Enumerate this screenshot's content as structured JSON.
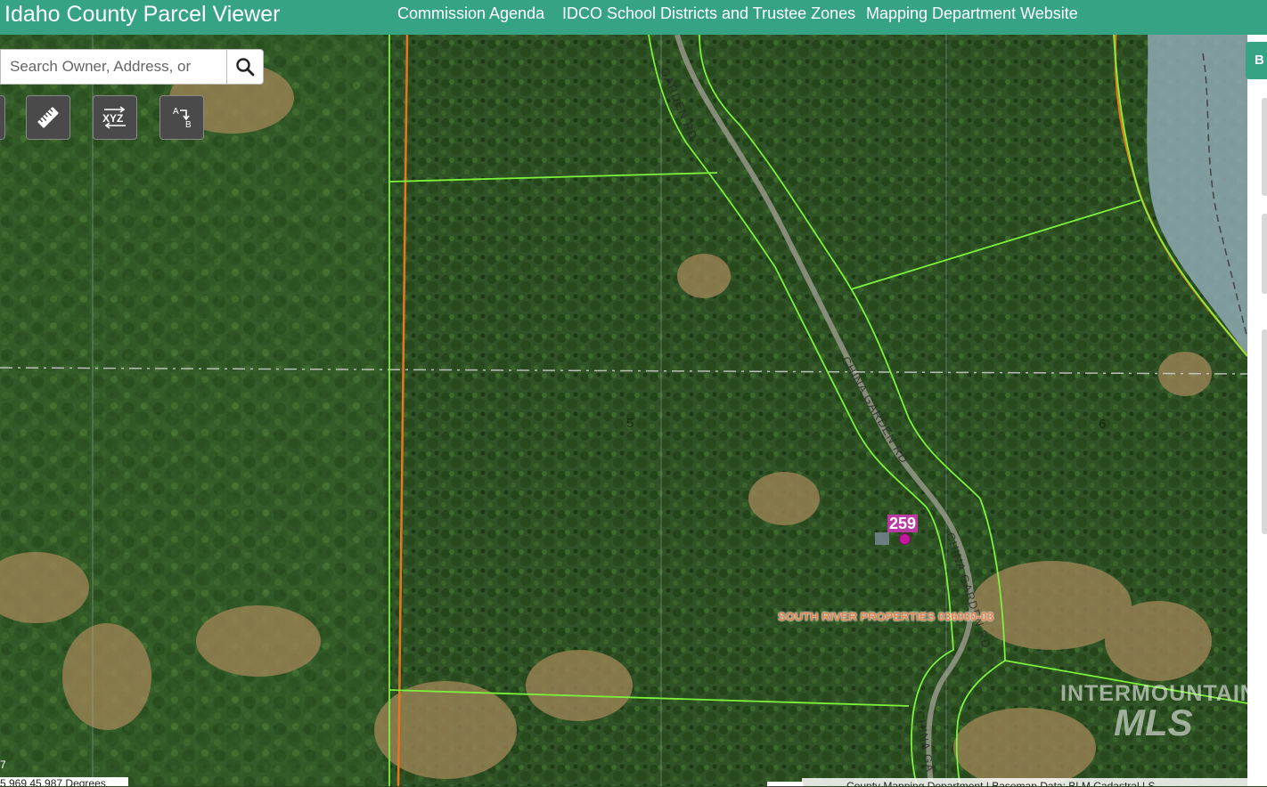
{
  "header": {
    "title": "Idaho County Parcel Viewer",
    "links": [
      "Commission Agenda",
      "IDCO School Districts and Trustee Zones",
      "Mapping Department Website"
    ],
    "background_color": "#35a384"
  },
  "search": {
    "placeholder": "Search Owner, Address, or",
    "value": ""
  },
  "tools": [
    {
      "name": "measure",
      "icon": "ruler-icon",
      "label": ""
    },
    {
      "name": "coordinates",
      "icon": "xyz-icon",
      "label": "XYZ"
    },
    {
      "name": "directions",
      "icon": "a-to-b-icon",
      "label": "A B"
    }
  ],
  "right_panel": {
    "tab_label": "B"
  },
  "map": {
    "road_labels": [
      "GARDEN RD",
      "CHINA GARDEN RD",
      "CHINA GARDEN RD",
      "CHINA GA"
    ],
    "section_numbers": [
      "5",
      "6"
    ],
    "address_number": "259",
    "owner_label": "SOUTH RIVER PROPERTIES 036000-03",
    "parcel_line_color": "#7cf23a",
    "boundary_line_color": "#e8761e",
    "address_color": "#c4179d"
  },
  "watermark": {
    "line1": "INTERMOUNTAIN",
    "line2": "MLS"
  },
  "footer": {
    "coordinates": "5 969 45.987 Degrees",
    "zoom_text": "7",
    "attribution": "County Mapping Department | Basemap Data: BLM Cadastral | S"
  }
}
